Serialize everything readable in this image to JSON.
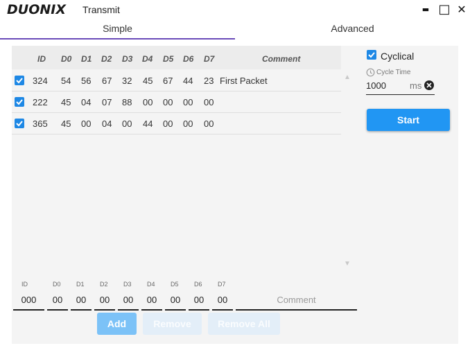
{
  "window": {
    "logo": "DUONIX",
    "title": "Transmit",
    "minimize": "▬",
    "maximize": "□",
    "close": "✕"
  },
  "tabs": [
    {
      "label": "Simple",
      "active": true
    },
    {
      "label": "Advanced",
      "active": false
    }
  ],
  "table": {
    "columns": [
      "ID",
      "D0",
      "D1",
      "D2",
      "D3",
      "D4",
      "D5",
      "D6",
      "D7",
      "Comment"
    ],
    "rows": [
      {
        "checked": true,
        "id": "324",
        "d0": "54",
        "d1": "56",
        "d2": "67",
        "d3": "32",
        "d4": "45",
        "d5": "67",
        "d6": "44",
        "d7": "23",
        "comment": "First Packet"
      },
      {
        "checked": true,
        "id": "222",
        "d0": "45",
        "d1": "04",
        "d2": "07",
        "d3": "88",
        "d4": "00",
        "d5": "00",
        "d6": "00",
        "d7": "00",
        "comment": ""
      },
      {
        "checked": true,
        "id": "365",
        "d0": "45",
        "d1": "00",
        "d2": "04",
        "d3": "00",
        "d4": "44",
        "d5": "00",
        "d6": "00",
        "d7": "00",
        "comment": ""
      }
    ]
  },
  "editor": {
    "labels": {
      "id": "ID",
      "d0": "D0",
      "d1": "D1",
      "d2": "D2",
      "d3": "D3",
      "d4": "D4",
      "d5": "D5",
      "d6": "D6",
      "d7": "D7"
    },
    "values": {
      "id": "000",
      "d0": "00",
      "d1": "00",
      "d2": "00",
      "d3": "00",
      "d4": "00",
      "d5": "00",
      "d6": "00",
      "d7": "00"
    },
    "comment_placeholder": "Comment"
  },
  "buttons": {
    "add": "Add",
    "remove": "Remove",
    "remove_all": "Remove All"
  },
  "cyclic": {
    "label": "Cyclical",
    "checked": true,
    "time_label": "Cycle Time",
    "time_value": "1000",
    "unit": "ms"
  },
  "start_label": "Start",
  "colors": {
    "accent": "#2196f3",
    "tab_underline": "#6a4ab8",
    "checkbox": "#1e88e5"
  }
}
